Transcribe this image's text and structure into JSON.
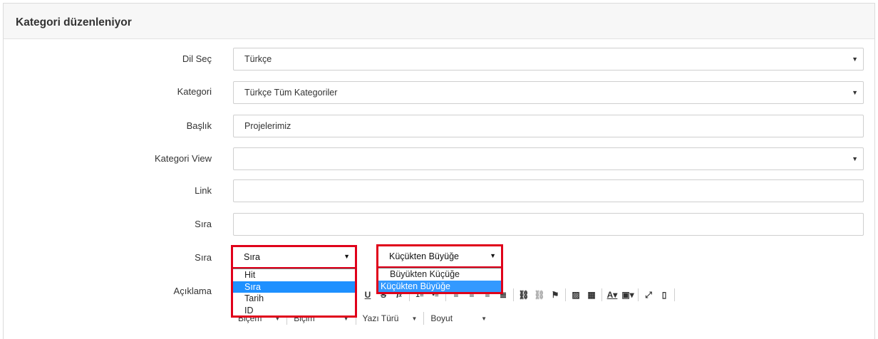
{
  "panel": {
    "title": "Kategori düzenleniyor"
  },
  "form": {
    "language": {
      "label": "Dil Seç",
      "value": "Türkçe"
    },
    "category": {
      "label": "Kategori",
      "value": "Türkçe Tüm Kategoriler"
    },
    "title": {
      "label": "Başlık",
      "value": "Projelerimiz"
    },
    "category_view": {
      "label": "Kategori View",
      "value": ""
    },
    "link": {
      "label": "Link",
      "value": ""
    },
    "order": {
      "label": "Sıra",
      "value": ""
    },
    "sort": {
      "label": "Sıra",
      "field_select": {
        "value": "Sıra",
        "options": [
          "Hit",
          "Sıra",
          "Tarih",
          "ID"
        ],
        "highlighted": "Sıra"
      },
      "direction_select": {
        "value": "Küçükten Büyüğe",
        "options": [
          "Büyükten Küçüğe",
          "Küçükten Büyüğe"
        ],
        "highlighted": "Küçükten Büyüğe"
      }
    },
    "description": {
      "label": "Açıklama"
    }
  },
  "editor": {
    "toolbar": [
      "underline",
      "strikethrough",
      "remove-format",
      "numbered-list",
      "bulleted-list",
      "align-left",
      "align-center",
      "align-right",
      "justify",
      "link",
      "unlink",
      "anchor",
      "image",
      "table",
      "text-color",
      "background-color",
      "maximize",
      "show-blocks"
    ],
    "combos": {
      "format1": "Biçem",
      "format2": "Biçim",
      "font": "Yazı Türü",
      "size": "Boyut"
    }
  },
  "colors": {
    "highlight_border": "#e0001a",
    "selected_option": "#1e90ff"
  }
}
